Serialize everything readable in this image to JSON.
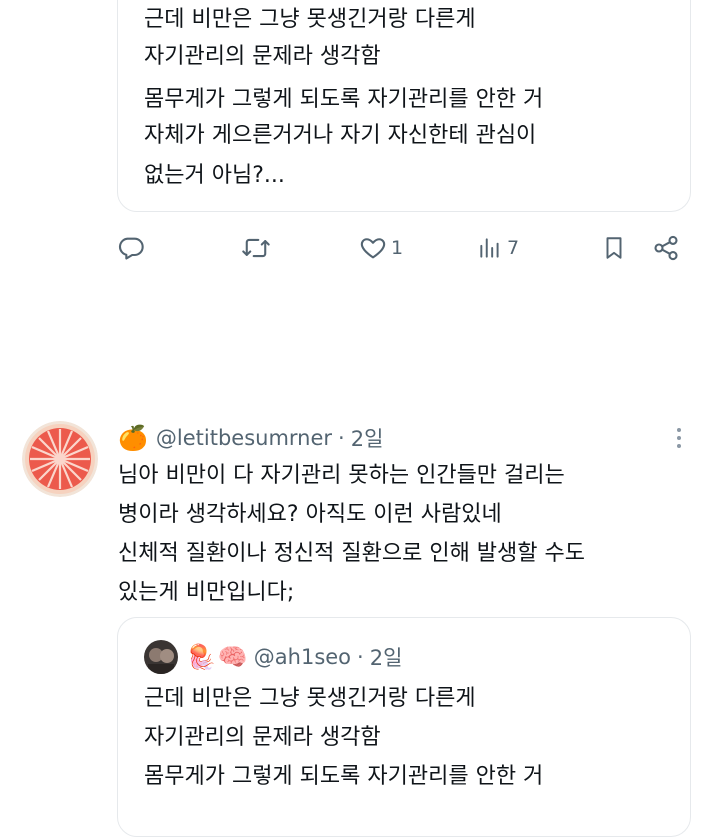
{
  "top_quote": {
    "lines": [
      "근데 비만은 그냥 못생긴거랑 다른게",
      "자기관리의 문제라 생각함",
      "몸무게가 그렇게 되도록 자기관리를 안한 거",
      "자체가 게으른거거나 자기 자신한테 관심이",
      "없는거 아님?..."
    ]
  },
  "actions": {
    "reply_icon": "reply-icon",
    "repost_icon": "repost-icon",
    "like_icon": "heart-icon",
    "like_count": "1",
    "views_icon": "views-icon",
    "views_count": "7",
    "bookmark_icon": "bookmark-icon",
    "share_icon": "share-icon"
  },
  "reply": {
    "handle_emoji": "🍊",
    "handle": "@letitbesumrner",
    "separator": "·",
    "time": "2일",
    "lines": [
      "님아 비만이 다 자기관리 못하는 인간들만 걸리는",
      "병이라 생각하세요? 아직도 이런 사람있네",
      "신체적 질환이나 정신적 질환으로 인해 발생할 수도",
      "있는게 비만입니다;"
    ]
  },
  "quoted": {
    "emojis": [
      "🪼",
      "🧠"
    ],
    "handle": "@ah1seo",
    "separator": "·",
    "time": "2일",
    "lines": [
      "근데 비만은 그냥 못생긴거랑 다른게",
      "자기관리의 문제라 생각함",
      "몸무게가 그렇게 되도록 자기관리를 안한 거"
    ]
  }
}
